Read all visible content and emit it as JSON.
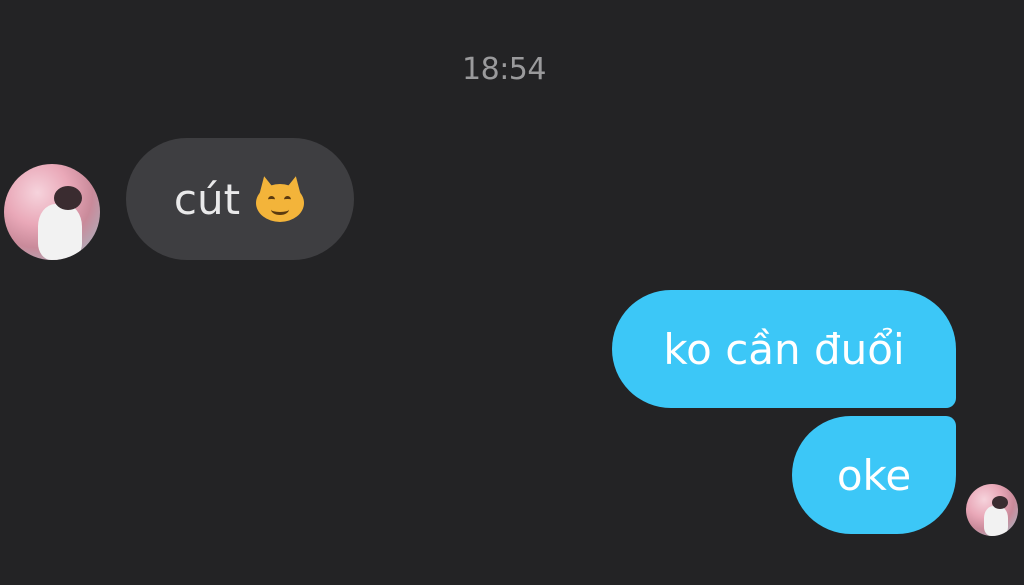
{
  "chat": {
    "timestamp": "18:54",
    "messages": [
      {
        "sender": "other",
        "text": "cút",
        "emoji": "smirking-cat-face"
      },
      {
        "sender": "self",
        "text": "ko cần đuổi"
      },
      {
        "sender": "self",
        "text": "oke"
      }
    ]
  },
  "colors": {
    "background": "#232325",
    "incoming_bubble": "#3e3e41",
    "outgoing_bubble": "#3cc7f7",
    "timestamp_text": "#9a9a9c"
  }
}
